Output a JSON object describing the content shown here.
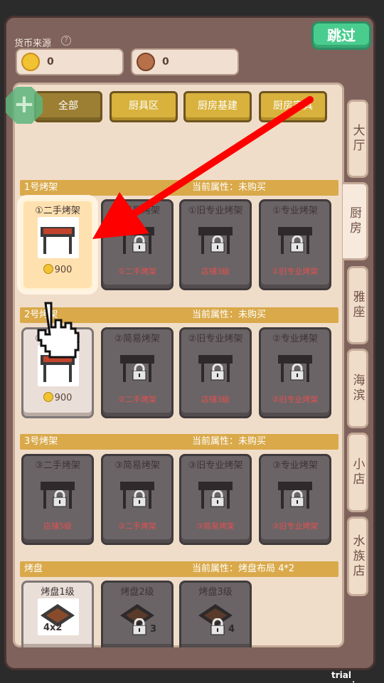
{
  "header": {
    "currency_label": "货币来源",
    "help_icon": "?",
    "coin_amount": "0",
    "cookie_amount": "0",
    "skip_label": "跳过"
  },
  "plus_label": "+",
  "filters": [
    "全部",
    "厨具区",
    "厨房基建",
    "厨房家具"
  ],
  "side_tabs": [
    "大厅",
    "厨房",
    "雅座",
    "海滨",
    "小店",
    "水族店"
  ],
  "sections": [
    {
      "name": "1号烤架",
      "attr": "当前属性：未购买",
      "cards": [
        {
          "title": "①二手烤架",
          "price": "900"
        },
        {
          "title": "①简易烤架",
          "req": "①二手烤架"
        },
        {
          "title": "①旧专业烤架",
          "req": "店铺3级"
        },
        {
          "title": "①专业烤架",
          "req": "①旧专业烤架"
        }
      ]
    },
    {
      "name": "2号烤架",
      "attr": "当前属性：未购买",
      "cards": [
        {
          "title": "②二手烤架",
          "price": "900"
        },
        {
          "title": "②简易烤架",
          "req": "②二手烤架"
        },
        {
          "title": "②旧专业烤架",
          "req": "店铺3级"
        },
        {
          "title": "②专业烤架",
          "req": "②旧专业烤架"
        }
      ]
    },
    {
      "name": "3号烤架",
      "attr": "当前属性：未购买",
      "cards": [
        {
          "title": "③二手烤架",
          "req": "店铺5级"
        },
        {
          "title": "③简易烤架",
          "req": "③二手烤架"
        },
        {
          "title": "③旧专业烤架",
          "req": "③简易烤架"
        },
        {
          "title": "③专业烤架",
          "req": "③旧专业烤架"
        }
      ]
    },
    {
      "name": "烤盘",
      "attr": "当前属性：烤盘布局 4*2",
      "cards": [
        {
          "title": "烤盘1级",
          "badge": "4x2"
        },
        {
          "title": "烤盘2级",
          "badge": "3"
        },
        {
          "title": "烤盘3级",
          "badge": "4"
        }
      ]
    }
  ],
  "watermark": "trial version",
  "colors": {
    "accent_green": "#49cd8e",
    "gold_tab": "#d8b23c",
    "section_bar": "#d9a94a",
    "lock_req_text": "#e45050"
  }
}
